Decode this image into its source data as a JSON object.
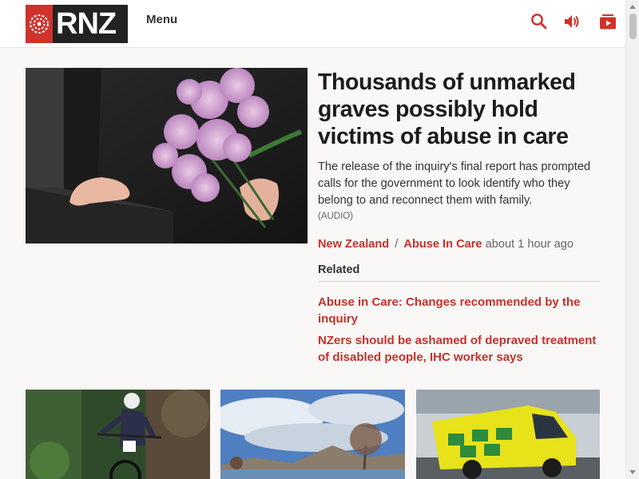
{
  "header": {
    "logo_text": "RNZ",
    "menu_label": "Menu",
    "icons": [
      "search-icon",
      "audio-icon",
      "tv-icon"
    ],
    "accent_color": "#d0322c"
  },
  "lead": {
    "title": "Thousands of unmarked graves possibly hold victims of abuse in care",
    "summary": "The release of the inquiry's final report has prompted calls for the government to look identify who they belong to and reconnect them with family.",
    "audio_tag": "(AUDIO)",
    "tag_1": "New Zealand",
    "tag_separator": "/",
    "tag_2": "Abuse In Care",
    "time": "about 1 hour ago",
    "related_heading": "Related",
    "related": [
      "Abuse in Care: Changes recommended by the inquiry",
      "NZers should be ashamed of depraved treatment of disabled people, IHC worker says"
    ]
  },
  "cards": [
    {
      "image": "mountain-biker-photo"
    },
    {
      "image": "lake-landscape-photo"
    },
    {
      "image": "ambulance-photo"
    }
  ]
}
